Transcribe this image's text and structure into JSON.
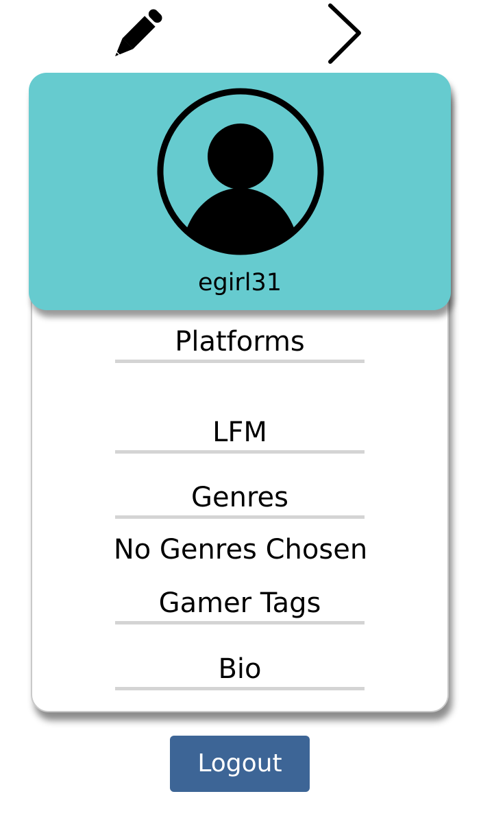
{
  "toolbar": {
    "edit_icon": "pencil-icon",
    "next_icon": "chevron-right-icon"
  },
  "profile": {
    "avatar_icon": "user-avatar-icon",
    "username": "egirl31",
    "header_color": "#66cbcf"
  },
  "sections": {
    "platforms": {
      "title": "Platforms"
    },
    "lfm": {
      "title": "LFM"
    },
    "genres": {
      "title": "Genres",
      "empty_text": "No Genres Chosen"
    },
    "gamer_tags": {
      "title": "Gamer Tags"
    },
    "bio": {
      "title": "Bio"
    }
  },
  "actions": {
    "logout_label": "Logout",
    "logout_color": "#3d6596"
  }
}
